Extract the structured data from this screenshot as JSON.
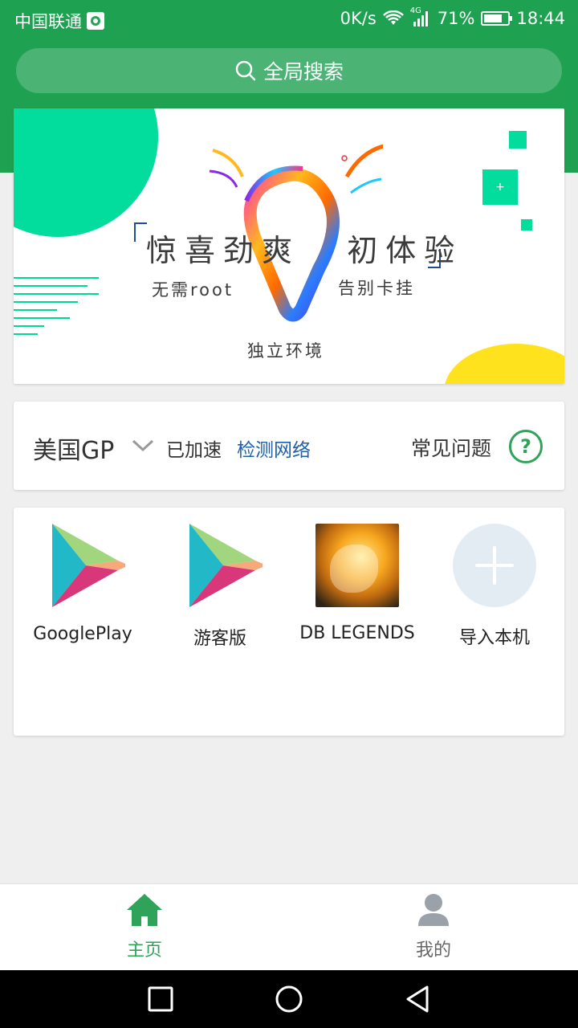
{
  "statusbar": {
    "carrier": "中国联通",
    "speed": "0K/s",
    "network_type": "4G",
    "battery": "71%",
    "time": "18:44"
  },
  "search": {
    "label": "全局搜索"
  },
  "banner": {
    "title_left": "惊喜劲爽",
    "title_right": "初体验",
    "subtitle_left": "无需root",
    "subtitle_right": "告别卡挂",
    "footer": "独立环境",
    "plus_symbol": "+"
  },
  "network": {
    "region": "美国GP",
    "status": "已加速",
    "detect_label": "检测网络",
    "faq_label": "常见问题",
    "faq_symbol": "?"
  },
  "apps": [
    {
      "label": "GooglePlay",
      "icon": "google-play-icon"
    },
    {
      "label": "游客版",
      "icon": "google-play-icon"
    },
    {
      "label": "DB LEGENDS",
      "icon": "db-legends-icon"
    },
    {
      "label": "导入本机",
      "icon": "add-icon"
    }
  ],
  "bottom_nav": {
    "home_label": "主页",
    "mine_label": "我的"
  },
  "colors": {
    "brand_green": "#1fa152",
    "accent_teal": "#02dc9c",
    "link_blue": "#1f5fa8",
    "inactive_gray": "#666666"
  }
}
